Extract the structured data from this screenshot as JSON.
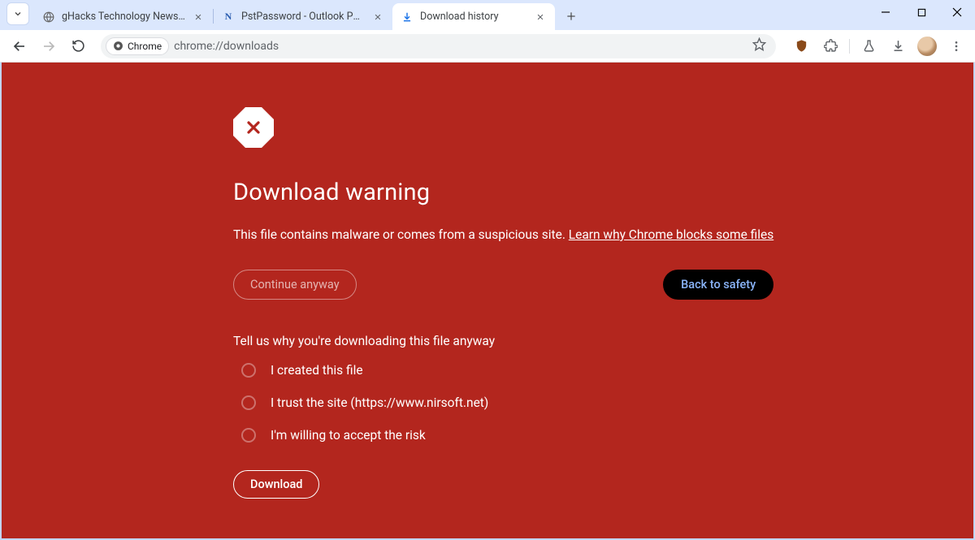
{
  "window": {
    "tabs": [
      {
        "title": "gHacks Technology News and A",
        "favicon": "globe"
      },
      {
        "title": "PstPassword - Outlook PST Pas",
        "favicon": "nirsoft"
      },
      {
        "title": "Download history",
        "favicon": "download",
        "active": true
      }
    ]
  },
  "toolbar": {
    "chip_label": "Chrome",
    "url": "chrome://downloads"
  },
  "page": {
    "heading": "Download warning",
    "description": "This file contains malware or comes from a suspicious site. ",
    "learn_link": "Learn why Chrome blocks some files",
    "continue_label": "Continue anyway",
    "back_label": "Back to safety",
    "survey_question": "Tell us why you're downloading this file anyway",
    "reasons": [
      "I created this file",
      "I trust the site (https://www.nirsoft.net)",
      "I'm willing to accept the risk"
    ],
    "download_label": "Download"
  }
}
